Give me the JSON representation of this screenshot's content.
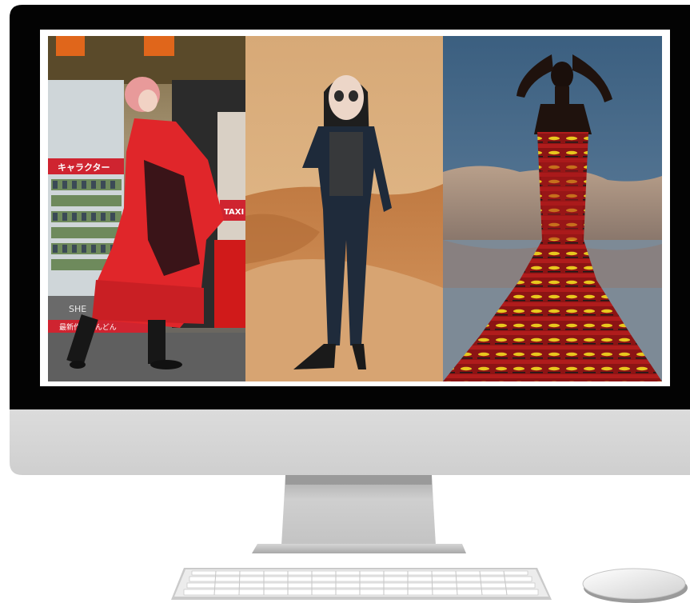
{
  "screen_panels": [
    {
      "subject": "pink-bob-haired model in red ruffled coat on a Tokyo street",
      "signs": {
        "katakana_banner": "キャラクター",
        "taxi": "TAXI",
        "bottom_banner": "最新作をどんどん",
        "shop": "SHE"
      }
    },
    {
      "subject": "3D avatar in black jacket and trousers standing in desert"
    },
    {
      "subject": "model in red and yellow printed mermaid gown by a lake with mountains"
    }
  ],
  "colors": {
    "bezel": "#030303",
    "chin": "#d9d9d9",
    "stand": "#bcbcbc",
    "keyboard": "#e4e4e4",
    "mouse": "#f3f3f3"
  }
}
